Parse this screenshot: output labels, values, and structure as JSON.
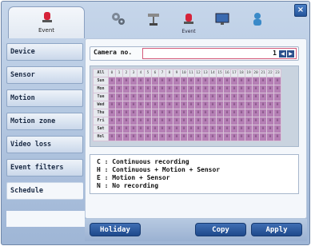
{
  "tabs": [
    {
      "label": "Event",
      "icon": "alarm-siren-icon",
      "active": true
    },
    {
      "label": "",
      "icon": "network-gears-icon"
    },
    {
      "label": "",
      "icon": "camera-icon"
    },
    {
      "label": "Event",
      "icon": "alarm-siren-icon"
    },
    {
      "label": "",
      "icon": "display-icon"
    },
    {
      "label": "",
      "icon": "user-key-icon"
    }
  ],
  "sidebar": {
    "items": [
      {
        "label": "Device"
      },
      {
        "label": "Sensor"
      },
      {
        "label": "Motion"
      },
      {
        "label": "Motion zone"
      },
      {
        "label": "Video loss"
      },
      {
        "label": "Event filters"
      },
      {
        "label": "Schedule"
      }
    ]
  },
  "camera": {
    "label": "Camera no.",
    "value": "1"
  },
  "schedule": {
    "corner": "All",
    "hours": [
      "0",
      "1",
      "2",
      "3",
      "4",
      "5",
      "6",
      "7",
      "8",
      "9",
      "10",
      "11",
      "12",
      "13",
      "14",
      "15",
      "16",
      "17",
      "18",
      "19",
      "20",
      "21",
      "22",
      "23"
    ],
    "days": [
      "Sun",
      "Mon",
      "Tue",
      "Wed",
      "Thu",
      "Fri",
      "Sat",
      "Hol"
    ],
    "cell_mode": "H"
  },
  "legend": [
    "C : Continuous recording",
    "H : Continuous + Motion + Sensor",
    "E : Motion + Sensor",
    "N : No recording"
  ],
  "buttons": {
    "holiday": "Holiday",
    "copy": "Copy",
    "apply": "Apply"
  },
  "colors": {
    "accent": "#2b4f8c",
    "cell": "#b57fb5"
  }
}
